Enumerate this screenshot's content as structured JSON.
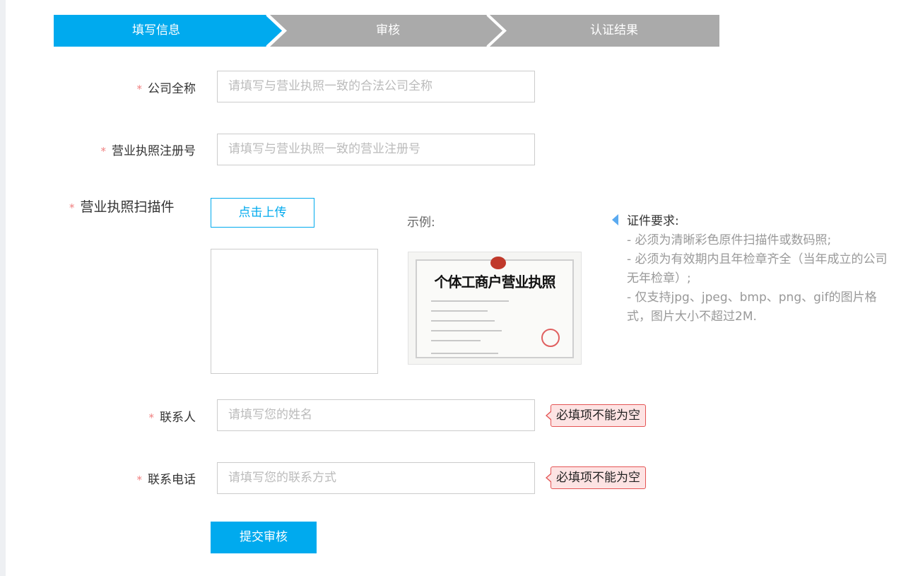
{
  "steps": [
    {
      "label": "填写信息",
      "state": "active"
    },
    {
      "label": "审核",
      "state": "inactive"
    },
    {
      "label": "认证结果",
      "state": "inactive"
    }
  ],
  "required_mark": "*",
  "form": {
    "company_name": {
      "label": "公司全称",
      "placeholder": "请填写与营业执照一致的合法公司全称",
      "value": ""
    },
    "registration_no": {
      "label": "营业执照注册号",
      "placeholder": "请填写与营业执照一致的营业注册号",
      "value": ""
    },
    "license_scan": {
      "label": "营业执照扫描件",
      "upload_button": "点击上传"
    },
    "contact_name": {
      "label": "联系人",
      "placeholder": "请填写您的姓名",
      "value": "",
      "error": "必填项不能为空"
    },
    "contact_phone": {
      "label": "联系电话",
      "placeholder": "请填写您的联系方式",
      "value": "",
      "error": "必填项不能为空"
    }
  },
  "example": {
    "label": "示例:",
    "license_title": "个体工商户营业执照"
  },
  "requirements": {
    "title": "证件要求:",
    "items": [
      "- 必须为清晰彩色原件扫描件或数码照;",
      "- 必须为有效期内且年检章齐全（当年成立的公司无年检章）;",
      "- 仅支持jpg、jpeg、bmp、png、gif的图片格式，图片大小不超过2M."
    ]
  },
  "submit_button": "提交审核",
  "colors": {
    "accent": "#00aaee",
    "inactive_step": "#aaaaaa",
    "error_bg": "#fde3e3",
    "error_border": "#e45454",
    "required_star": "#f08080"
  }
}
